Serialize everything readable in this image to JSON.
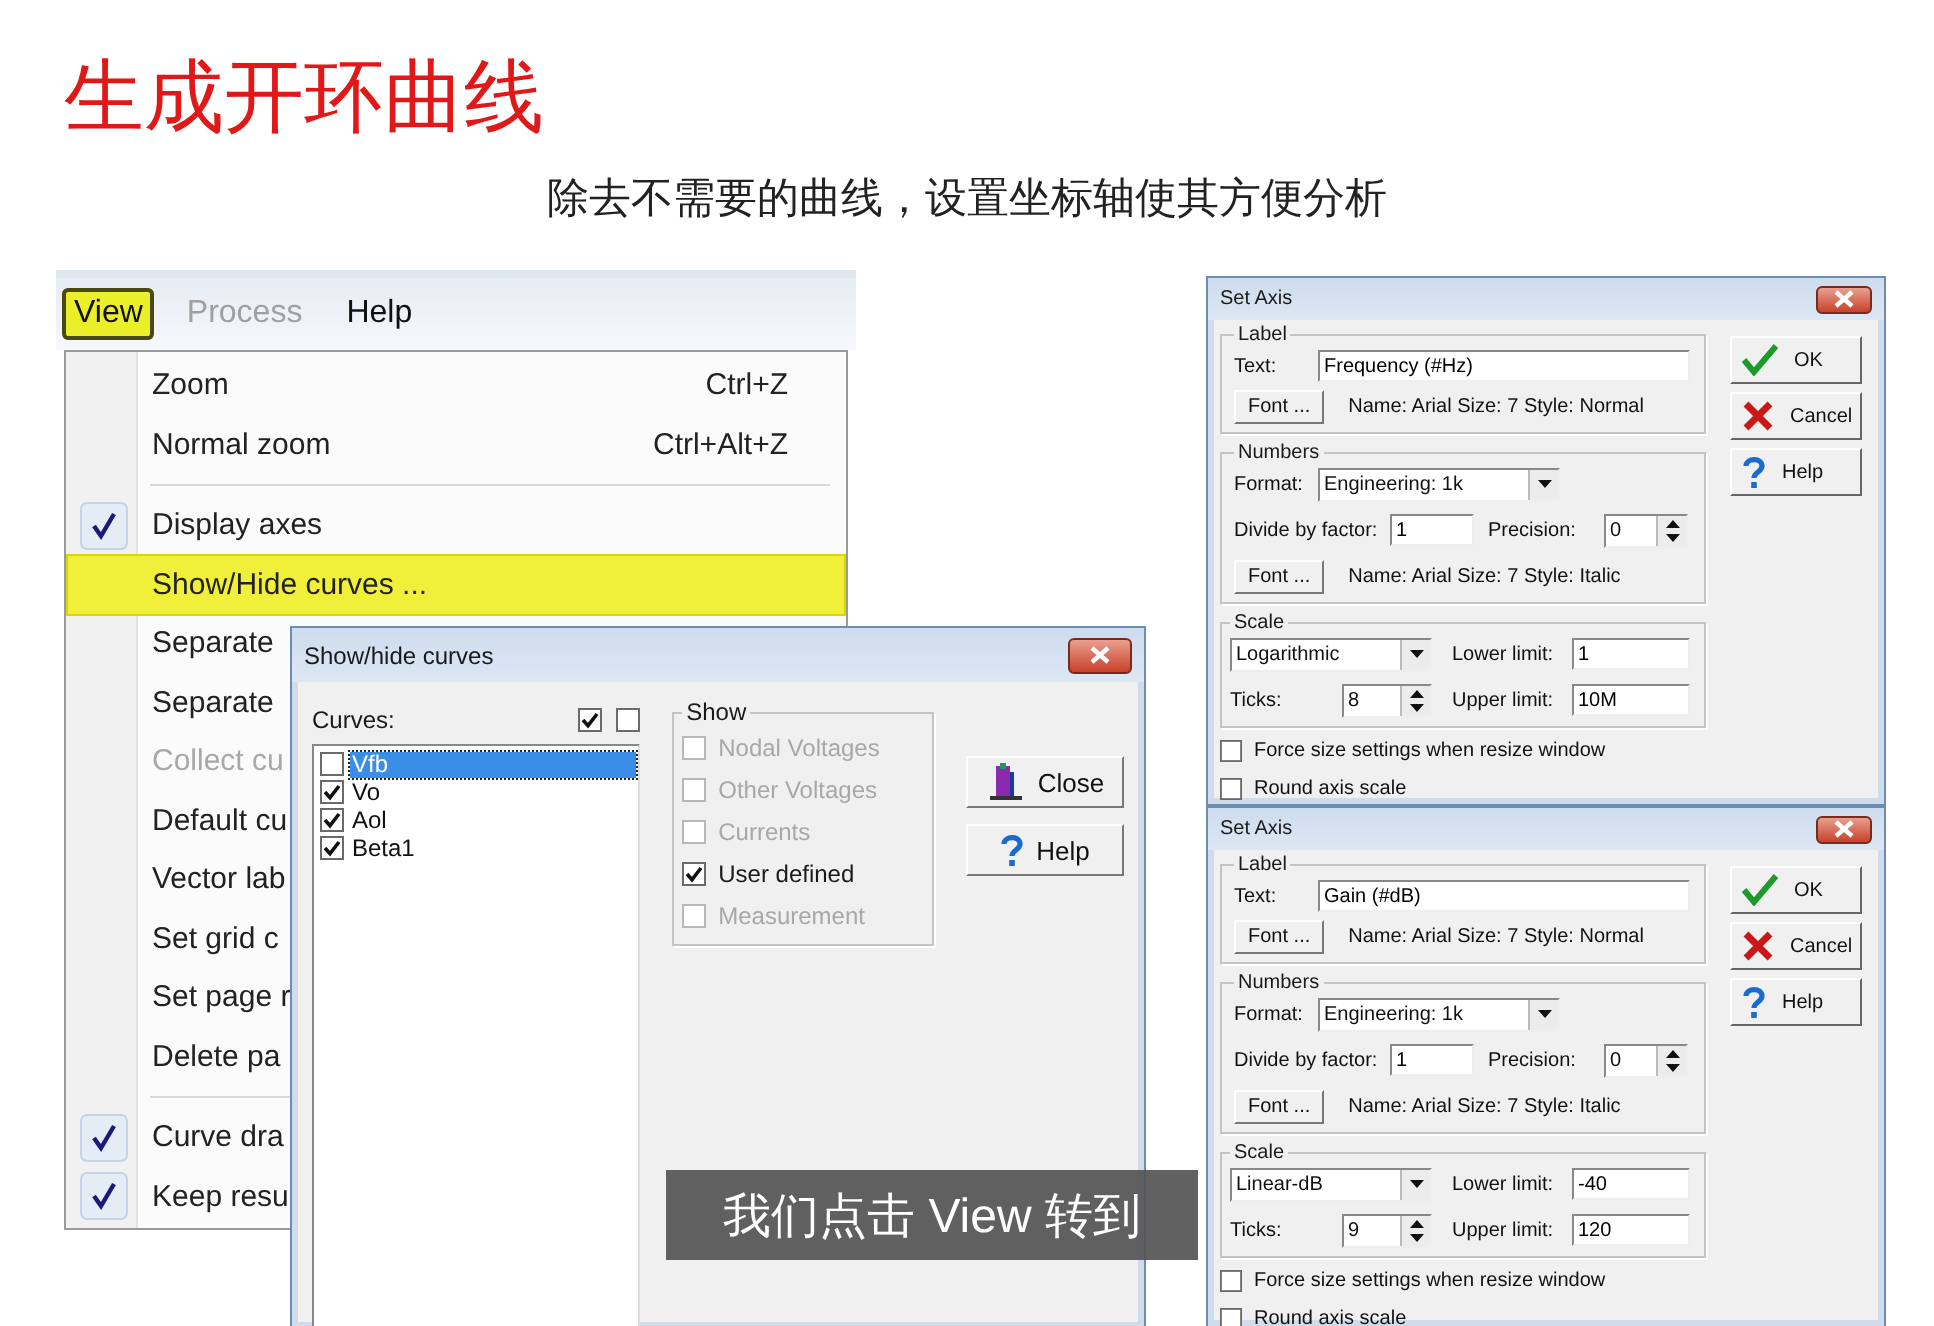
{
  "slide": {
    "title": "生成开环曲线",
    "subtitle": "除去不需要的曲线，设置坐标轴使其方便分析"
  },
  "menu_bar": [
    {
      "label": "View",
      "selected": true,
      "disabled": false
    },
    {
      "label": "Process",
      "selected": false,
      "disabled": true
    },
    {
      "label": "Help",
      "selected": false,
      "disabled": false
    }
  ],
  "menu_items": [
    {
      "kind": "item",
      "label": "Zoom",
      "shortcut": "Ctrl+Z",
      "checked": false,
      "disabled": false,
      "selected": false
    },
    {
      "kind": "item",
      "label": "Normal zoom",
      "shortcut": "Ctrl+Alt+Z",
      "checked": false,
      "disabled": false,
      "selected": false
    },
    {
      "kind": "separator"
    },
    {
      "kind": "item",
      "label": "Display axes",
      "checked": true,
      "disabled": false,
      "selected": false
    },
    {
      "kind": "item",
      "label": "Show/Hide curves ...",
      "checked": false,
      "disabled": false,
      "selected": true
    },
    {
      "kind": "item",
      "label": "Separate",
      "checked": false,
      "disabled": false,
      "selected": false
    },
    {
      "kind": "item",
      "label": "Separate",
      "checked": false,
      "disabled": false,
      "selected": false
    },
    {
      "kind": "item",
      "label": "Collect cu",
      "checked": false,
      "disabled": true,
      "selected": false
    },
    {
      "kind": "item",
      "label": "Default cu",
      "checked": false,
      "disabled": false,
      "selected": false
    },
    {
      "kind": "item",
      "label": "Vector lab",
      "checked": false,
      "disabled": false,
      "selected": false
    },
    {
      "kind": "item",
      "label": "Set grid c",
      "checked": false,
      "disabled": false,
      "selected": false
    },
    {
      "kind": "item",
      "label": "Set page r",
      "checked": false,
      "disabled": false,
      "selected": false
    },
    {
      "kind": "item",
      "label": "Delete pa",
      "checked": false,
      "disabled": false,
      "selected": false
    },
    {
      "kind": "separator"
    },
    {
      "kind": "item",
      "label": "Curve dra",
      "checked": true,
      "disabled": false,
      "selected": false
    },
    {
      "kind": "item",
      "label": "Keep resu",
      "checked": true,
      "disabled": false,
      "selected": false
    }
  ],
  "show_hide_dialog": {
    "title": "Show/hide curves",
    "curves_label": "Curves:",
    "header_boxes": [
      {
        "checked": true
      },
      {
        "checked": false
      }
    ],
    "curves": [
      {
        "name": "Vfb",
        "checked": false,
        "selected": true
      },
      {
        "name": "Vo",
        "checked": true,
        "selected": false
      },
      {
        "name": "Aol",
        "checked": true,
        "selected": false
      },
      {
        "name": "Beta1",
        "checked": true,
        "selected": false
      }
    ],
    "show_group": {
      "title": "Show",
      "options": [
        {
          "label": "Nodal Voltages",
          "checked": false,
          "disabled": true
        },
        {
          "label": "Other Voltages",
          "checked": false,
          "disabled": true
        },
        {
          "label": "Currents",
          "checked": false,
          "disabled": true
        },
        {
          "label": "User defined",
          "checked": true,
          "disabled": false
        },
        {
          "label": "Measurement",
          "checked": false,
          "disabled": true
        }
      ]
    },
    "buttons": [
      {
        "kind": "close",
        "label": "Close"
      },
      {
        "kind": "help",
        "label": "Help"
      }
    ]
  },
  "set_axis_dialogs": [
    {
      "title": "Set Axis",
      "label_group": {
        "title": "Label",
        "text_label": "Text:",
        "text_value": "Frequency (#Hz)",
        "font_button": "Font ...",
        "font_info": "Name: Arial Size: 7 Style: Normal"
      },
      "numbers_group": {
        "title": "Numbers",
        "format_label": "Format:",
        "format_value": "Engineering: 1k",
        "divide_label": "Divide by factor:",
        "divide_value": "1",
        "precision_label": "Precision:",
        "precision_value": "0",
        "font_button": "Font ...",
        "font_info": "Name: Arial Size: 7 Style: Italic"
      },
      "scale_group": {
        "title": "Scale",
        "scale_type": "Logarithmic",
        "lower_label": "Lower limit:",
        "lower_value": "1",
        "ticks_label": "Ticks:",
        "ticks_value": "8",
        "upper_label": "Upper limit:",
        "upper_value": "10M"
      },
      "options": [
        {
          "label": "Force size settings when resize window",
          "checked": false
        },
        {
          "label": "Round axis scale",
          "checked": false
        }
      ],
      "buttons": [
        {
          "kind": "ok",
          "label": "OK"
        },
        {
          "kind": "cancel",
          "label": "Cancel"
        },
        {
          "kind": "help",
          "label": "Help"
        }
      ]
    },
    {
      "title": "Set Axis",
      "label_group": {
        "title": "Label",
        "text_label": "Text:",
        "text_value": "Gain (#dB)",
        "font_button": "Font ...",
        "font_info": "Name: Arial Size: 7 Style: Normal"
      },
      "numbers_group": {
        "title": "Numbers",
        "format_label": "Format:",
        "format_value": "Engineering: 1k",
        "divide_label": "Divide by factor:",
        "divide_value": "1",
        "precision_label": "Precision:",
        "precision_value": "0",
        "font_button": "Font ...",
        "font_info": "Name: Arial Size: 7 Style: Italic"
      },
      "scale_group": {
        "title": "Scale",
        "scale_type": "Linear-dB",
        "lower_label": "Lower limit:",
        "lower_value": "-40",
        "ticks_label": "Ticks:",
        "ticks_value": "9",
        "upper_label": "Upper limit:",
        "upper_value": "120"
      },
      "options": [
        {
          "label": "Force size settings when resize window",
          "checked": false
        },
        {
          "label": "Round axis scale",
          "checked": false
        }
      ],
      "buttons": [
        {
          "kind": "ok",
          "label": "OK"
        },
        {
          "kind": "cancel",
          "label": "Cancel"
        },
        {
          "kind": "help",
          "label": "Help"
        }
      ]
    }
  ],
  "caption": "我们点击 View 转到"
}
